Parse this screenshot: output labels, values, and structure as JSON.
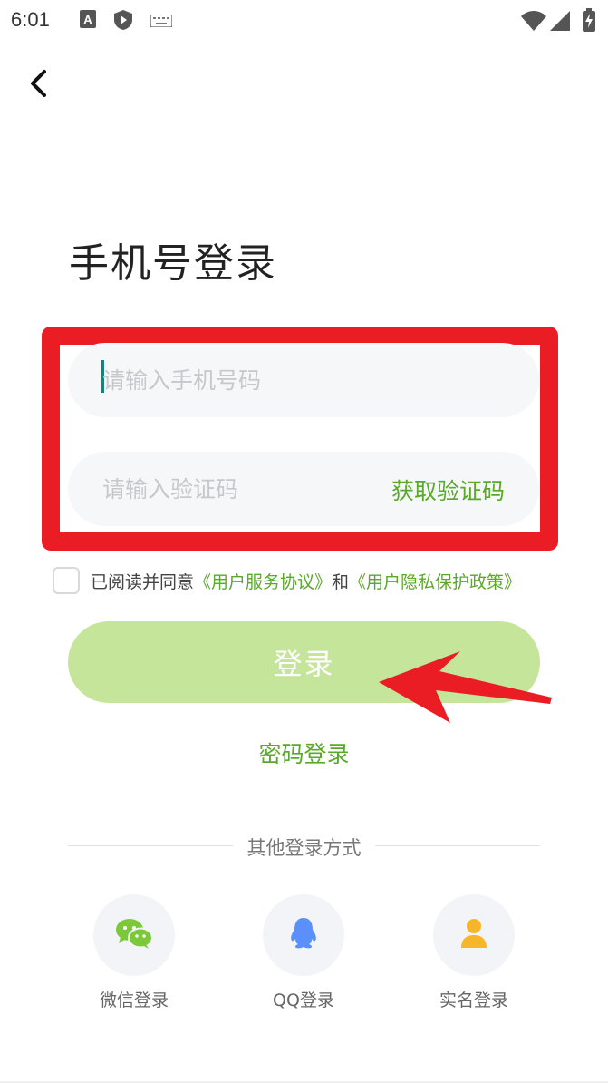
{
  "status_bar": {
    "time": "6:01",
    "icons": [
      "text-a-icon",
      "shield-icon",
      "keyboard-icon",
      "wifi-icon",
      "signal-icon",
      "battery-charging-icon"
    ]
  },
  "header": {
    "back_icon": "chevron-left-icon"
  },
  "page_title": "手机号登录",
  "form": {
    "phone_placeholder": "请输入手机号码",
    "phone_value": "",
    "code_placeholder": "请输入验证码",
    "code_value": "",
    "get_code_label": "获取验证码"
  },
  "agreement": {
    "checked": false,
    "prefix": "已阅读并同意",
    "service_link": "《用户服务协议》",
    "and": "和",
    "privacy_link": "《用户隐私保护政策》"
  },
  "login_button_label": "登录",
  "password_login_label": "密码登录",
  "other_login": {
    "divider_label": "其他登录方式",
    "options": [
      {
        "label": "微信登录",
        "icon": "wechat-icon",
        "color": "#7bc93a"
      },
      {
        "label": "QQ登录",
        "icon": "qq-icon",
        "color": "#5b8ff9"
      },
      {
        "label": "实名登录",
        "icon": "person-icon",
        "color": "#f7b52c"
      }
    ]
  },
  "colors": {
    "accent_green": "#5aa92a",
    "login_button": "#c5e59a",
    "highlight_red": "#ea1c24",
    "input_bg": "#f6f7f9"
  }
}
